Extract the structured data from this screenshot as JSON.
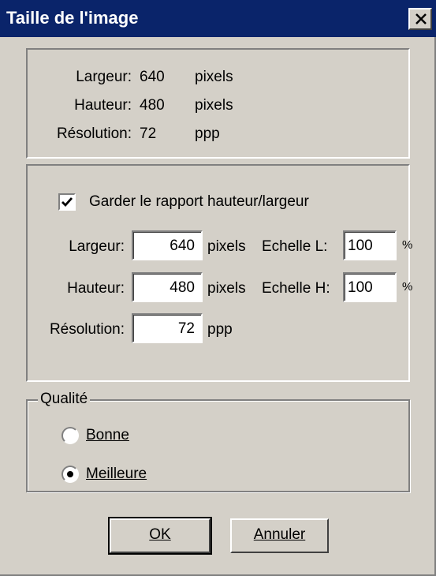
{
  "window": {
    "title": "Taille de l'image"
  },
  "info": {
    "width_label": "Largeur:",
    "width_value": "640",
    "width_unit": "pixels",
    "height_label": "Hauteur:",
    "height_value": "480",
    "height_unit": "pixels",
    "resolution_label": "Résolution:",
    "resolution_value": "72",
    "resolution_unit": "ppp"
  },
  "resize": {
    "keep_ratio_label": "Garder le rapport hauteur/largeur",
    "keep_ratio_checked": true,
    "width_label": "Largeur:",
    "width_value": "640",
    "width_unit": "pixels",
    "scale_w_label": "Echelle L:",
    "scale_w_value": "100",
    "percent_symbol": "%",
    "height_label": "Hauteur:",
    "height_value": "480",
    "height_unit": "pixels",
    "scale_h_label": "Echelle H:",
    "scale_h_value": "100",
    "resolution_label": "Résolution:",
    "resolution_value": "72",
    "resolution_unit": "ppp"
  },
  "quality": {
    "legend": "Qualité",
    "option_good": "Bonne",
    "option_best": "Meilleure",
    "selected": "Meilleure"
  },
  "buttons": {
    "ok_label": "OK",
    "cancel_label": "Annuler"
  }
}
